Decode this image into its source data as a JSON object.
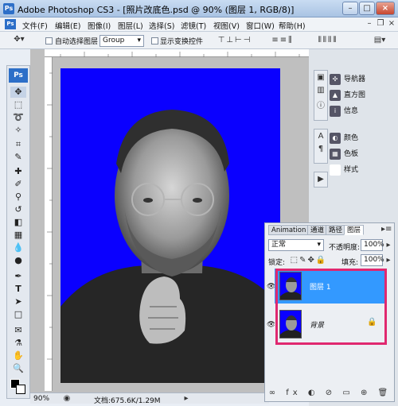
{
  "window": {
    "app_title": "Adobe Photoshop CS3 - [照片改底色.psd @ 90% (图层 1, RGB/8)]",
    "ps_logo": "Ps",
    "minimize": "–",
    "maximize": "□",
    "close": "×"
  },
  "menu": [
    "文件(F)",
    "编辑(E)",
    "图像(I)",
    "图层(L)",
    "选择(S)",
    "滤镜(T)",
    "视图(V)",
    "窗口(W)",
    "帮助(H)"
  ],
  "options": {
    "auto_select_label": "自动选择图层",
    "auto_select_value": "Group",
    "show_transform_label": "显示变换控件"
  },
  "panels": {
    "navigator": "导航器",
    "histogram": "直方图",
    "info": "信息",
    "color": "颜色",
    "swatches": "色板",
    "styles": "样式"
  },
  "layers_panel": {
    "tabs": [
      "Animation",
      "通道",
      "路径",
      "图层"
    ],
    "blend_mode": "正常",
    "opacity_label": "不透明度:",
    "opacity_value": "100%",
    "lock_label": "锁定:",
    "fill_label": "填充:",
    "fill_value": "100%",
    "layers": [
      {
        "name": "图层 1",
        "selected": true
      },
      {
        "name": "背景",
        "locked": true
      }
    ]
  },
  "status": {
    "zoom": "90%",
    "doc_info": "文档:675.6K/1.29M"
  },
  "colors": {
    "canvas_bg": "#0a00ff",
    "selection_highlight": "#3399ff",
    "annotation_box": "#e0286f"
  }
}
